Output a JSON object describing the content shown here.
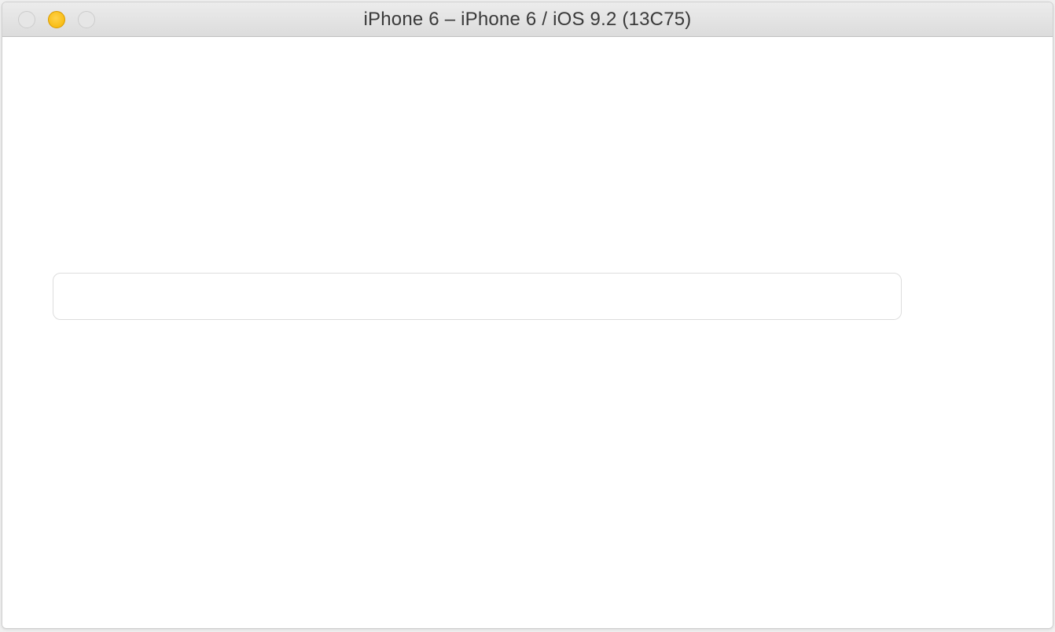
{
  "window": {
    "title": "iPhone 6 – iPhone 6 / iOS 9.2 (13C75)"
  },
  "content": {
    "textfield_value": "",
    "textfield_placeholder": ""
  }
}
